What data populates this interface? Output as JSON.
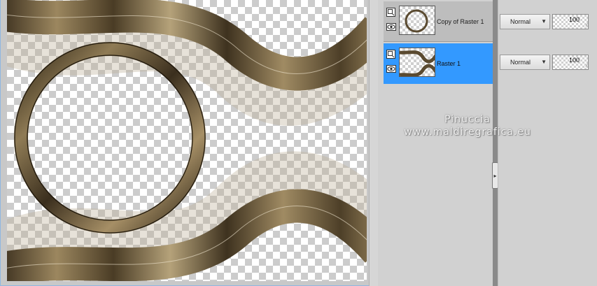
{
  "layers": [
    {
      "name": "Copy of Raster 1",
      "blend_mode": "Normal",
      "opacity": "100",
      "selected": false
    },
    {
      "name": "Raster 1",
      "blend_mode": "Normal",
      "opacity": "100",
      "selected": true
    }
  ],
  "watermark": {
    "line1": "Pinuccia",
    "line2": "www.maldiregrafica.eu"
  },
  "icons": {
    "layer_type": "layer-type-icon",
    "visibility": "eye-icon",
    "dropdown": "chevron-down-icon",
    "splitter": "chevron-right-icon"
  },
  "colors": {
    "selected_row": "#3399ff",
    "ribbon_gold": "#8a7550",
    "ribbon_dark": "#3b2f1e"
  }
}
